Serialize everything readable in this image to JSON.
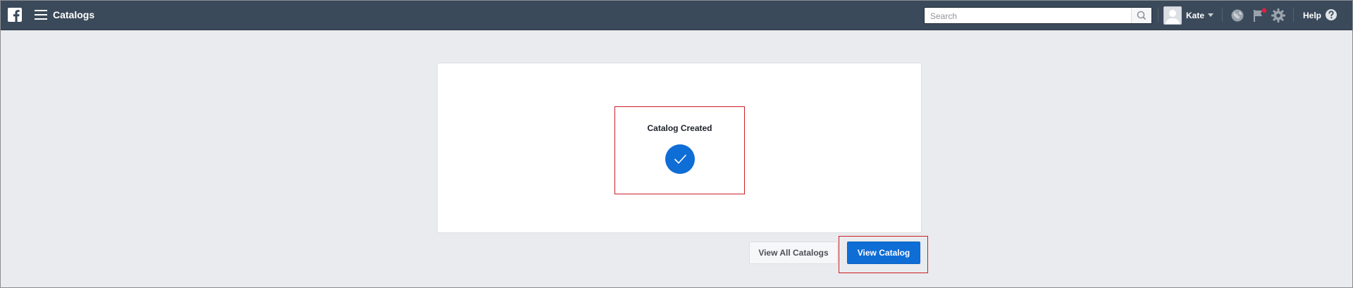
{
  "topbar": {
    "app_title": "Catalogs",
    "search": {
      "placeholder": "Search"
    },
    "user": {
      "name": "Kate"
    },
    "help_label": "Help"
  },
  "card": {
    "status_title": "Catalog Created"
  },
  "actions": {
    "view_all_label": "View All Catalogs",
    "view_catalog_label": "View Catalog"
  },
  "colors": {
    "topbar_bg": "#3b4a5a",
    "accent": "#0f6dd6",
    "page_bg": "#e9ebee",
    "highlight": "#cc1f27",
    "notification": "#e41e3f"
  },
  "icons": [
    "facebook-logo-icon",
    "menu-icon",
    "search-icon",
    "avatar-placeholder-icon",
    "chevron-down-icon",
    "globe-icon",
    "flag-icon",
    "gear-icon",
    "help-icon",
    "checkmark-icon"
  ]
}
